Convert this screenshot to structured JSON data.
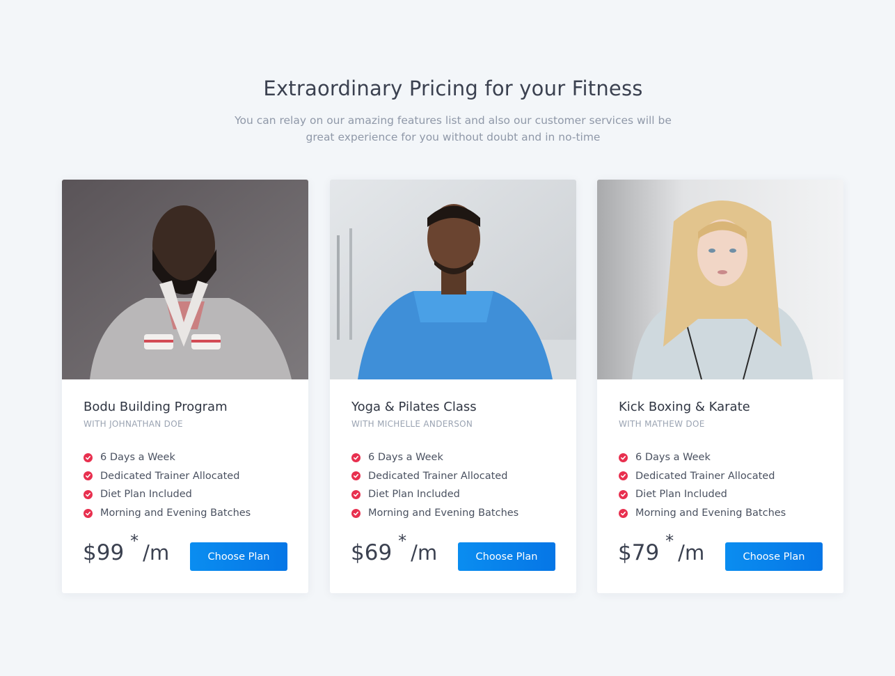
{
  "header": {
    "title": "Extraordinary Pricing for your Fitness",
    "subtitle": "You can relay on our amazing features list and also our customer services will be great experience for you without doubt and in no-time"
  },
  "colors": {
    "page_bg": "#f3f6f9",
    "accent_blue": "#0a84ec",
    "check_red": "#e8304f"
  },
  "plans": [
    {
      "name": "Bodu Building Program",
      "trainer": "WITH JOHNATHAN DOE",
      "features": [
        "6 Days a Week",
        "Dedicated Trainer Allocated",
        "Diet Plan Included",
        "Morning and Evening Batches"
      ],
      "price": "$99",
      "asterisk": "*",
      "period": "/m",
      "button": "Choose Plan"
    },
    {
      "name": "Yoga & Pilates Class",
      "trainer": "WITH MICHELLE ANDERSON",
      "features": [
        "6 Days a Week",
        "Dedicated Trainer Allocated",
        "Diet Plan Included",
        "Morning and Evening Batches"
      ],
      "price": "$69",
      "asterisk": "*",
      "period": "/m",
      "button": "Choose Plan"
    },
    {
      "name": "Kick Boxing & Karate",
      "trainer": "WITH MATHEW DOE",
      "features": [
        "6 Days a Week",
        "Dedicated Trainer Allocated",
        "Diet Plan Included",
        "Morning and Evening Batches"
      ],
      "price": "$79",
      "asterisk": "*",
      "period": "/m",
      "button": "Choose Plan"
    }
  ]
}
